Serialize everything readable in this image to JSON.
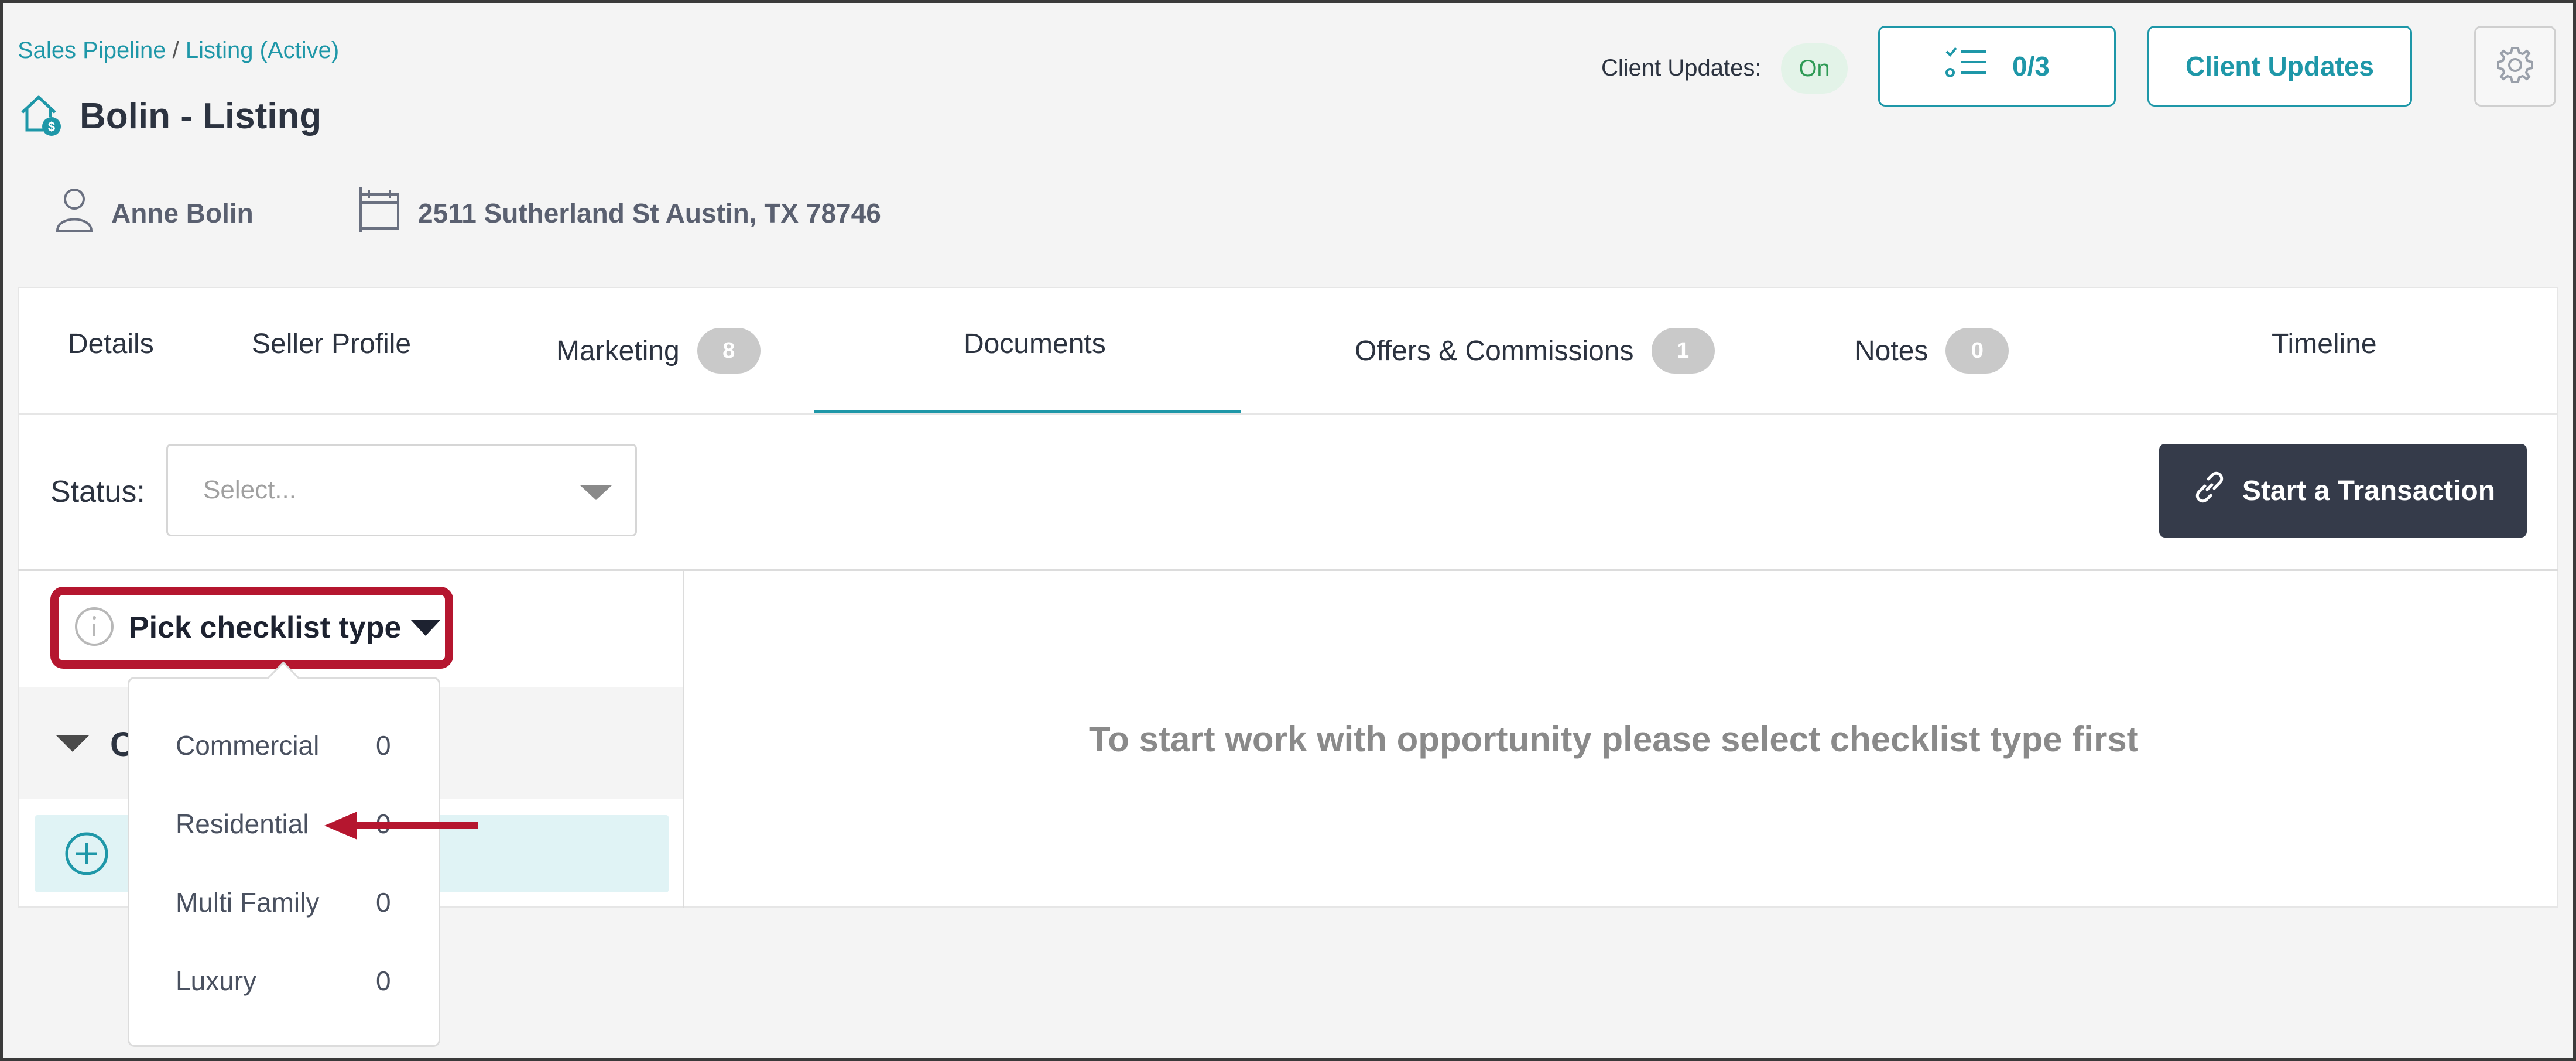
{
  "breadcrumb": {
    "parent": "Sales Pipeline",
    "separator": "/",
    "current": "Listing (Active)"
  },
  "page_title": "Bolin - Listing",
  "meta": {
    "client_name": "Anne Bolin",
    "address": "2511 Sutherland St Austin, TX 78746"
  },
  "client_updates": {
    "label": "Client Updates:",
    "status": "On",
    "checklist_count": "0/3",
    "button_label": "Client Updates"
  },
  "tabs": [
    {
      "label": "Details"
    },
    {
      "label": "Seller Profile"
    },
    {
      "label": "Marketing",
      "badge": "8"
    },
    {
      "label": "Documents",
      "active": true
    },
    {
      "label": "Offers & Commissions",
      "badge": "1"
    },
    {
      "label": "Notes",
      "badge": "0"
    },
    {
      "label": "Timeline"
    }
  ],
  "status": {
    "label": "Status:",
    "placeholder": "Select..."
  },
  "transaction_button": "Start a Transaction",
  "checklist": {
    "pick_label": "Pick checklist type",
    "group_letter": "C",
    "options": [
      {
        "name": "Commercial",
        "count": "0"
      },
      {
        "name": "Residential",
        "count": "0"
      },
      {
        "name": "Multi Family",
        "count": "0"
      },
      {
        "name": "Luxury",
        "count": "0"
      }
    ]
  },
  "empty_message": "To start work with opportunity please select checklist type first",
  "colors": {
    "accent": "#1e97a8",
    "highlight": "#b5162f",
    "dark_button": "#353b4a",
    "on_badge_bg": "#e3f3e8",
    "on_badge_text": "#2e9a55"
  },
  "icons": {
    "listing": "house-dollar-icon",
    "client": "person-icon",
    "address": "calendar-building-icon",
    "checklist": "checklist-icon",
    "settings": "gear-icon",
    "link": "link-icon",
    "info": "info-icon",
    "add": "plus-circle-icon"
  }
}
